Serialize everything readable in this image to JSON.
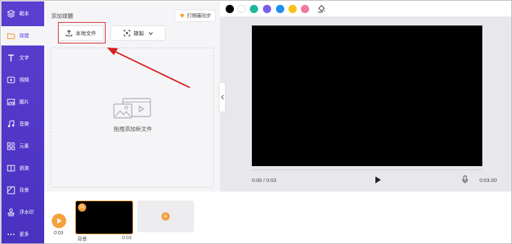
{
  "sidebar": {
    "items": [
      {
        "label": "範本",
        "icon": "layers-icon"
      },
      {
        "label": "媒體",
        "icon": "folder-icon",
        "active": true
      },
      {
        "label": "文字",
        "icon": "text-icon"
      },
      {
        "label": "視頻",
        "icon": "video-icon"
      },
      {
        "label": "圖片",
        "icon": "image-icon"
      },
      {
        "label": "音樂",
        "icon": "music-icon"
      },
      {
        "label": "元素",
        "icon": "elements-icon"
      },
      {
        "label": "過渡",
        "icon": "transition-icon"
      },
      {
        "label": "背景",
        "icon": "background-icon"
      },
      {
        "label": "浮水印",
        "icon": "stamp-icon"
      },
      {
        "label": "更多",
        "icon": "more-icon"
      }
    ]
  },
  "media_panel": {
    "title": "添加媒體",
    "upgrade_label": "打開審同步",
    "upload_label": "本地文件",
    "record_label": "錄製",
    "drop_text": "拖拽添加新文件"
  },
  "preview": {
    "swatches": [
      "#000000",
      "#ffffff",
      "#1fb79b",
      "#7a5de8",
      "#1e8ff0",
      "#f7c21a",
      "#f07aa0"
    ],
    "time_current": "0:00 / 0:03",
    "time_total": "0:03.00"
  },
  "timeline": {
    "duration": "0:03",
    "clip_badge": "01",
    "clip_label": "背景",
    "clip_duration": "0:03"
  },
  "colors": {
    "accent": "#5b3fd0",
    "orange": "#f5a03a",
    "highlight": "#d62020"
  }
}
